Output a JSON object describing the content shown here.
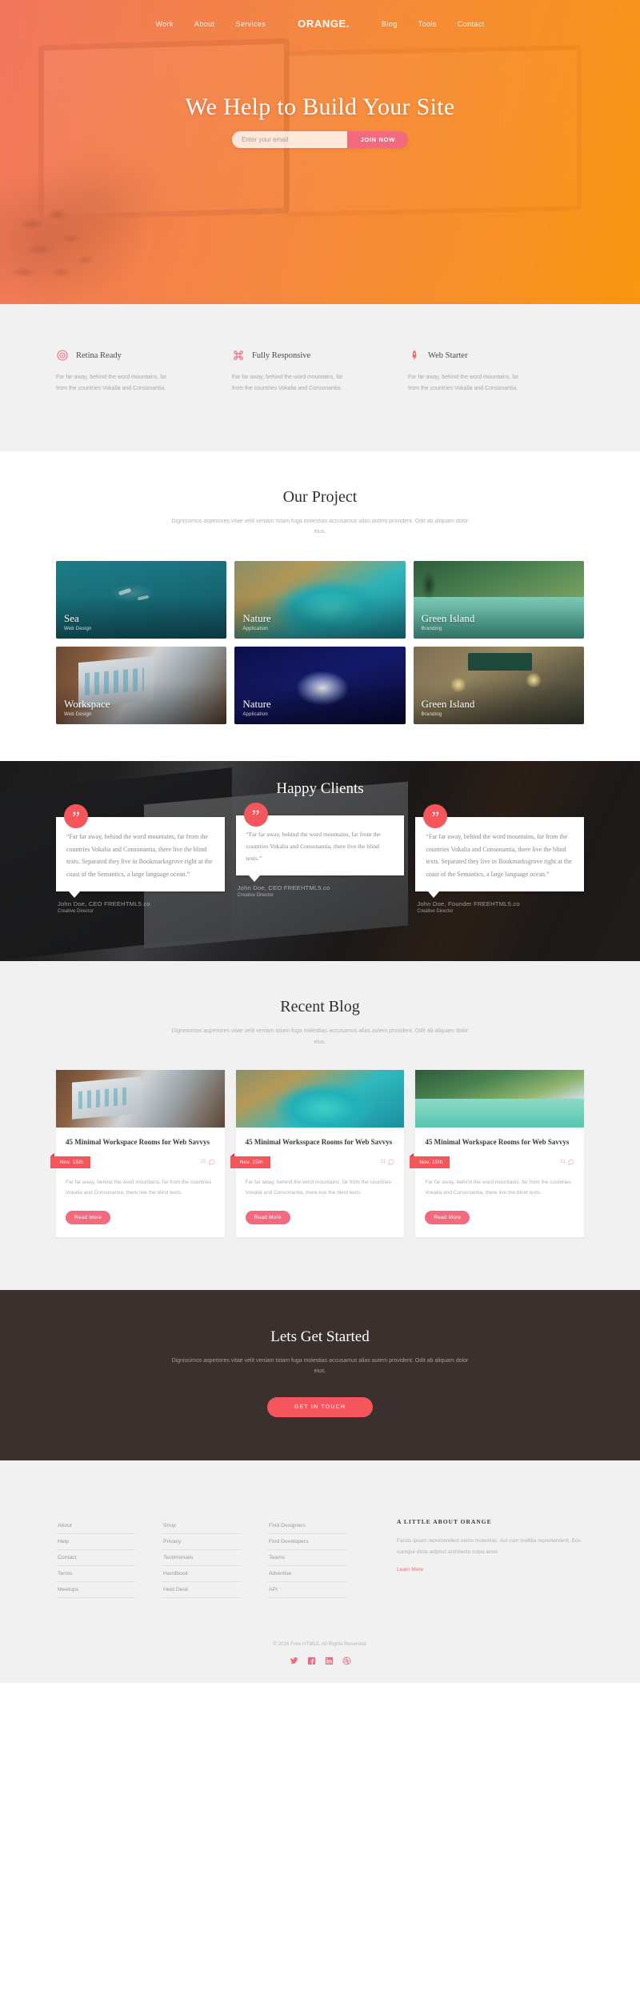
{
  "nav": {
    "brand": "ORANGE.",
    "left": [
      {
        "label": "Work"
      },
      {
        "label": "About"
      },
      {
        "label": "Services"
      }
    ],
    "right": [
      {
        "label": "Blog"
      },
      {
        "label": "Tools"
      },
      {
        "label": "Contact"
      }
    ]
  },
  "hero": {
    "title": "We Help to Build Your Site",
    "email_placeholder": "Enter your email",
    "email_value": "",
    "join_label": "JOIN NOW"
  },
  "features": [
    {
      "icon": "retina-target-icon",
      "title": "Retina Ready",
      "body": "Far far away, behind the word mountains, far from the countries Vokalia and Consonantia."
    },
    {
      "icon": "command-key-icon",
      "title": "Fully Responsive",
      "body": "Far far away, behind the word mountains, far from the countries Vokalia and Consonantia."
    },
    {
      "icon": "rocket-icon",
      "title": "Web Starter",
      "body": "Far far away, behind the word mountains, far from the countries Vokalia and Consonantia."
    }
  ],
  "projects": {
    "title": "Our Project",
    "subtitle": "Dignissimos asperiores vitae velit veniam totam fuga molestias accusamus alias autem provident. Odit ab aliquam dolor eius.",
    "items": [
      {
        "name": "Sea",
        "category": "Web Design"
      },
      {
        "name": "Nature",
        "category": "Application"
      },
      {
        "name": "Green Island",
        "category": "Branding"
      },
      {
        "name": "Workspace",
        "category": "Web Design"
      },
      {
        "name": "Nature",
        "category": "Application"
      },
      {
        "name": "Green Island",
        "category": "Branding"
      }
    ]
  },
  "clients": {
    "title": "Happy Clients",
    "testimonials": [
      {
        "quote": "“Far far away, behind the word mountains, far from the countries Vokalia and Consonantia, there live the blind texts. Separated they live in Bookmarksgrove right at the coast of the Semantics, a large language ocean.”",
        "name": "John Doe, CEO",
        "company": "FREEHTML5.co",
        "role": "Creative Director"
      },
      {
        "quote": "“Far far away, behind the word mountains, far from the countries Vokalia and Consonantia, there live the blind texts.”",
        "name": "John Doe, CEO",
        "company": "FREEHTML5.co",
        "role": "Creative Director"
      },
      {
        "quote": "“Far far away, behind the word mountains, far from the countries Vokalia and Consonantia, there live the blind texts. Separated they live in Bookmarksgrove right at the coast of the Semantics, a large language ocean.”",
        "name": "John Doe, Founder",
        "company": "FREEHTML5.co",
        "role": "Creative Director"
      }
    ]
  },
  "blog": {
    "title": "Recent Blog",
    "subtitle": "Dignissimos asperiores vitae velit veniam totam fuga molestias accusamus alias autem provident. Odit ab aliquam dolor eius.",
    "posts": [
      {
        "title": "45 Minimal Workspace Rooms for Web Savvys",
        "date": "Nov. 15th",
        "comments": "21",
        "excerpt": "Far far away, behind the word mountains, far from the countries Vokalia and Consonantia, there live the blind texts.",
        "more_label": "Read More"
      },
      {
        "title": "45 Minimal Worksspace Rooms for Web Savvys",
        "date": "Nov. 15th",
        "comments": "21",
        "excerpt": "Far far away, behind the word mountains, far from the countries Vokalia and Consonantia, there live the blind texts.",
        "more_label": "Read More"
      },
      {
        "title": "45 Minimal Workspace Rooms for Web Savvys",
        "date": "Nov. 15th",
        "comments": "21",
        "excerpt": "Far far away, behind the word mountains, far from the countries Vokalia and Consonantia, there live the blind texts.",
        "more_label": "Read More"
      }
    ]
  },
  "cta": {
    "title": "Lets Get Started",
    "subtitle": "Dignissimos asperiores vitae velit veniam totam fuga molestias accusamus alias autem provident. Odit ab aliquam dolor eius.",
    "button": "GET IN TOUCH"
  },
  "footer": {
    "columns": [
      [
        "About",
        "Help",
        "Contact",
        "Terms",
        "Meetups"
      ],
      [
        "Shop",
        "Privacy",
        "Testimonials",
        "Handbook",
        "Held Desk"
      ],
      [
        "Find Designers",
        "Find Developers",
        "Teams",
        "Advertise",
        "API"
      ]
    ],
    "about": {
      "heading": "A LITTLE ABOUT ORANGE",
      "body": "Facilis ipsum reprehenderit nemo molestias. Aut cum mollitia reprehenderit. Eos cumque dicta adipisci architecto culpa amet.",
      "learn_more": "Learn More"
    },
    "copyright": "© 2016 Free HTML5. All Rights Reserved.",
    "socials": [
      "twitter-icon",
      "facebook-icon",
      "linkedin-icon",
      "dribbble-icon"
    ]
  },
  "colors": {
    "accent_pink": "#f4697e",
    "accent_red": "#f4565b",
    "dark": "#3a302d",
    "light_bg": "#f1f1f1"
  }
}
